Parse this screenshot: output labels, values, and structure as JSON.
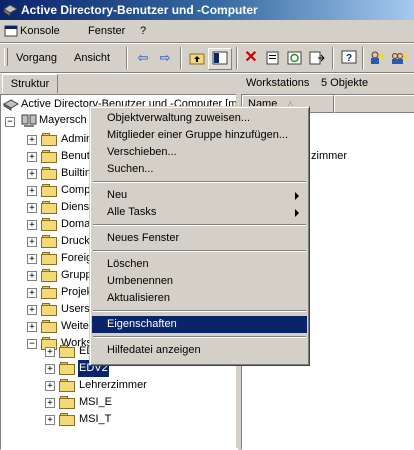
{
  "window": {
    "title": "Active Directory-Benutzer und -Computer"
  },
  "menubar": [
    {
      "label": "Konsole"
    },
    {
      "label": "Fenster"
    },
    {
      "label": "?"
    }
  ],
  "toolbar": {
    "vorgang": "Vorgang",
    "ansicht": "Ansicht"
  },
  "tabs": {
    "struktur": "Struktur"
  },
  "right_pane": {
    "header_title": "Workstations",
    "header_count": "5 Objekte",
    "column_name": "Name",
    "visible_item": "zimmer"
  },
  "tree": {
    "root": "Active Directory-Benutzer und -Computer [m",
    "domain": "Mayersch",
    "nodes": [
      {
        "label": "Admin"
      },
      {
        "label": "Benut"
      },
      {
        "label": "Builtin"
      },
      {
        "label": "Comp"
      },
      {
        "label": "Dienst"
      },
      {
        "label": "Doma"
      },
      {
        "label": "Druck"
      },
      {
        "label": "Foreig"
      },
      {
        "label": "Grupp"
      },
      {
        "label": "Projek"
      },
      {
        "label": "Users"
      },
      {
        "label": "Weite"
      },
      {
        "label": "Works"
      }
    ],
    "children": [
      {
        "label": "ED"
      },
      {
        "label": "EDV2"
      },
      {
        "label": "Lehrerzimmer"
      },
      {
        "label": "MSI_E"
      },
      {
        "label": "MSI_T"
      }
    ]
  },
  "context_menu": {
    "items": [
      {
        "label": "Objektverwaltung zuweisen..."
      },
      {
        "label": "Mitglieder einer Gruppe hinzufügen..."
      },
      {
        "label": "Verschieben..."
      },
      {
        "label": "Suchen..."
      },
      {
        "label": "Neu"
      },
      {
        "label": "Alle Tasks"
      },
      {
        "label": "Neues Fenster"
      },
      {
        "label": "Löschen"
      },
      {
        "label": "Umbenennen"
      },
      {
        "label": "Aktualisieren"
      },
      {
        "label": "Eigenschaften"
      },
      {
        "label": "Hilfedatei anzeigen"
      }
    ]
  }
}
